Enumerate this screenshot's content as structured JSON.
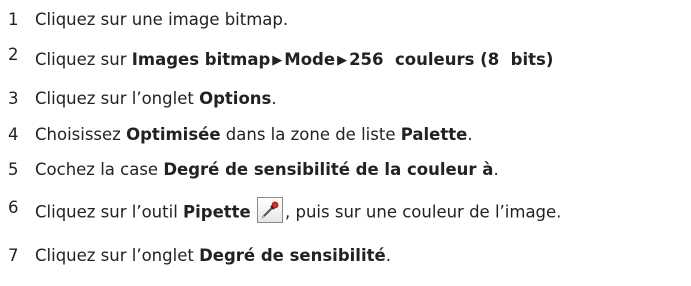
{
  "steps": [
    {
      "number": "1",
      "text": "Cliquez sur une image bitmap."
    },
    {
      "number": "2",
      "pre": "Cliquez sur ",
      "menu": [
        "Images bitmap",
        "Mode",
        "256  couleurs (8  bits)"
      ],
      "separator": "▶"
    },
    {
      "number": "3",
      "pre": "Cliquez sur l’onglet ",
      "bold": "Options",
      "post": "."
    },
    {
      "number": "4",
      "pre": "Choisissez ",
      "bold": "Optimisée",
      "mid": " dans la zone de liste ",
      "bold2": "Palette",
      "post": "."
    },
    {
      "number": "5",
      "pre": "Cochez la case ",
      "bold": "Degré de sensibilité de la couleur à",
      "post": "."
    },
    {
      "number": "6",
      "pre": "Cliquez sur l’outil ",
      "bold": "Pipette",
      "post": ", puis sur une couleur de l’image.",
      "icon": "eyedropper-icon"
    },
    {
      "number": "7",
      "pre": "Cliquez sur l’onglet ",
      "bold": "Degré de sensibilité",
      "post": "."
    }
  ]
}
